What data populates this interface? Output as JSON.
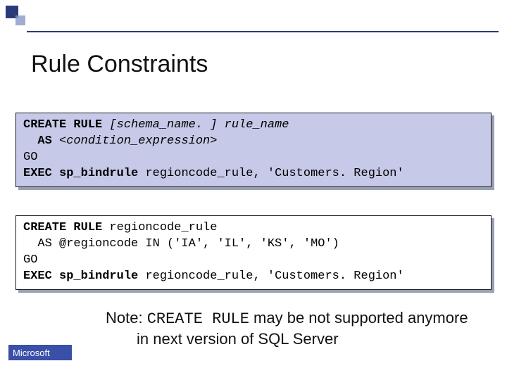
{
  "title": "Rule Constraints",
  "code1": {
    "l1a": "CREATE RULE ",
    "l1b": "[schema_name. ] rule_name",
    "l2a": "  AS ",
    "l2b": "<condition_expression>",
    "l3": "GO",
    "l4a": "EXEC sp_bindrule ",
    "l4b": "regioncode_rule, 'Customers. Region'"
  },
  "code2": {
    "l1a": "CREATE RULE ",
    "l1b": "regioncode_rule",
    "l2": "  AS @regioncode IN ('IA', 'IL', 'KS', 'MO')",
    "l3": "GO",
    "l4a": "EXEC sp_bindrule ",
    "l4b": "regioncode_rule, 'Customers. Region'"
  },
  "note": {
    "prefix": "Note: ",
    "code": "CREATE RULE",
    "rest1": " may be not supported anymore",
    "rest2": "in next version of SQL Server"
  },
  "footer": "Microsoft"
}
